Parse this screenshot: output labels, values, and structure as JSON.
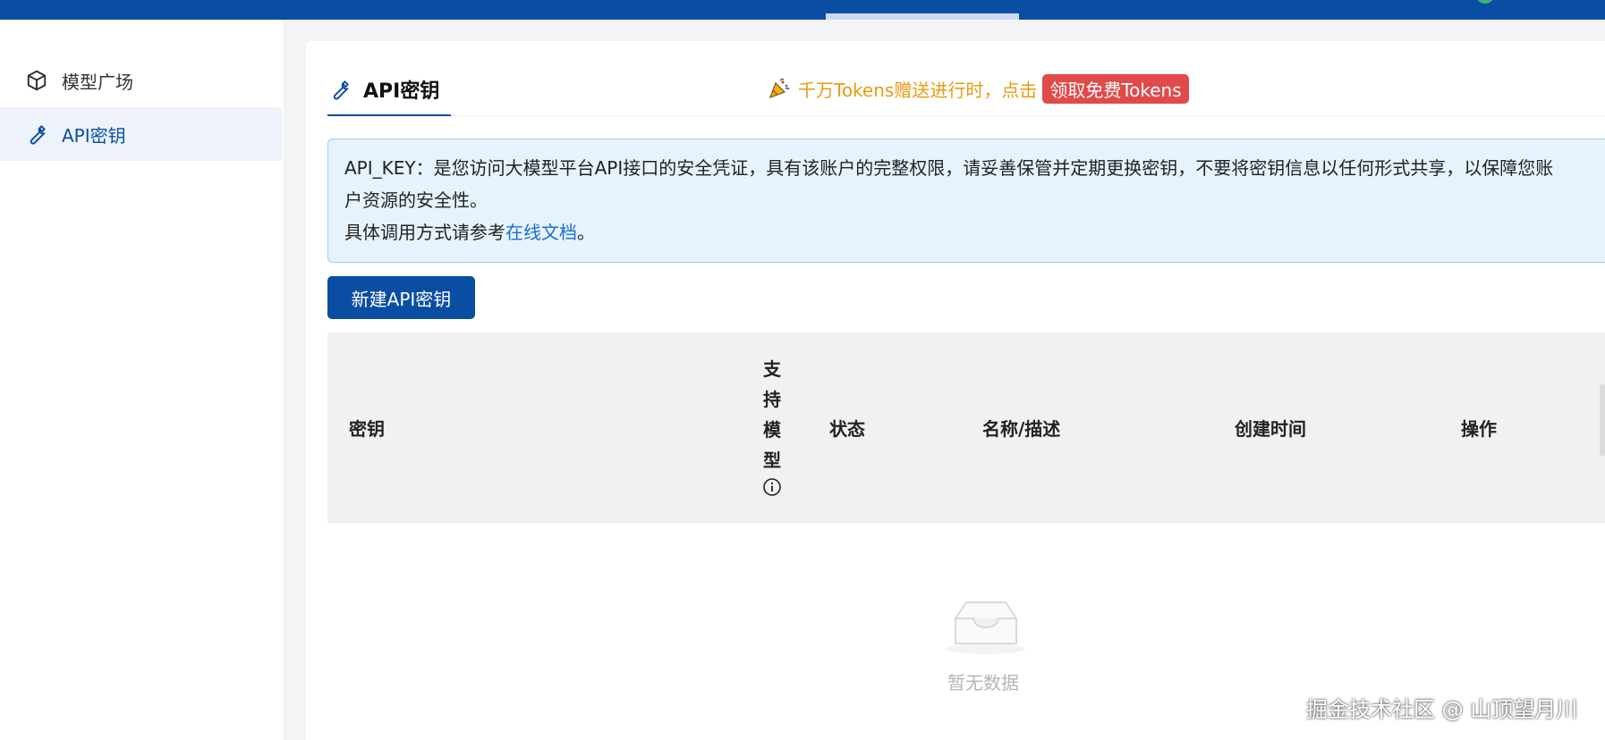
{
  "sidebar": {
    "items": [
      {
        "label": "模型广场",
        "icon": "cube-icon",
        "active": false
      },
      {
        "label": "API密钥",
        "icon": "wrench-icon",
        "active": true
      }
    ]
  },
  "page": {
    "title": "API密钥",
    "title_icon": "wrench-icon"
  },
  "promo": {
    "icon": "party-popper-icon",
    "text": "千万Tokens赠送进行时，点击",
    "badge_label": "领取免费Tokens"
  },
  "notice": {
    "line1": "API_KEY：是您访问大模型平台API接口的安全凭证，具有该账户的完整权限，请妥善保管并定期更换密钥，不要将密钥信息以任何形式共享，以保障您账",
    "line2": "户资源的安全性。",
    "line3_prefix": "具体调用方式请参考",
    "doc_link": "在线文档",
    "line3_suffix": "。"
  },
  "actions": {
    "create_label": "新建API密钥"
  },
  "table": {
    "columns": {
      "key": "密钥",
      "model_chars": [
        "支",
        "持",
        "模",
        "型"
      ],
      "status": "状态",
      "name": "名称/描述",
      "created": "创建时间",
      "ops": "操作"
    },
    "empty_text": "暂无数据"
  },
  "watermark": "掘金技术社区 @ 山顶望月川",
  "colors": {
    "brand": "#0a4ea3",
    "promo": "#e89a12",
    "badge": "#e24a4a",
    "notice_bg": "#e6f3fd",
    "link": "#1d6fd1"
  }
}
